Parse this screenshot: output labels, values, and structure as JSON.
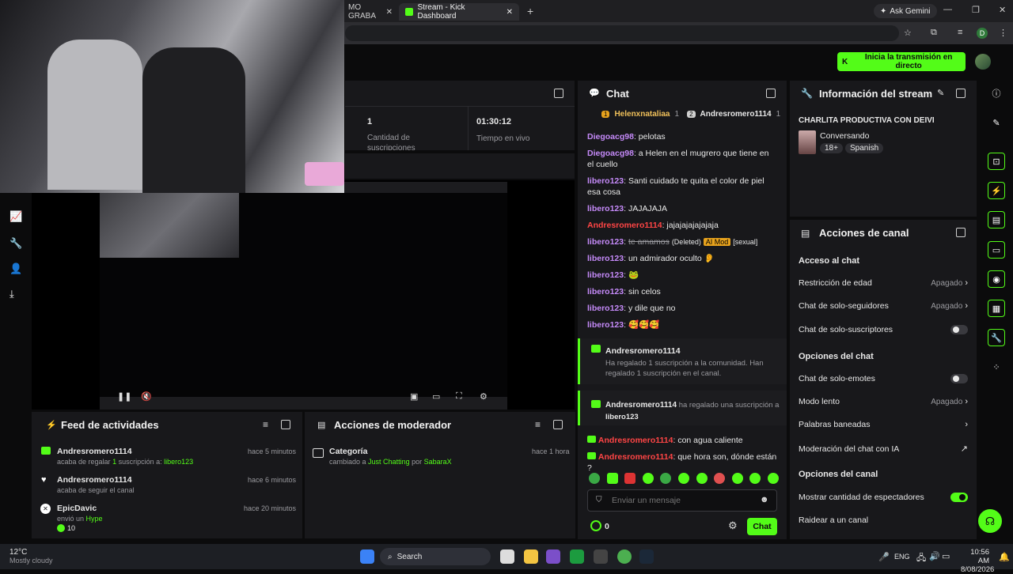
{
  "browser": {
    "tabs": [
      {
        "label": "MO GRABA"
      },
      {
        "label": "Stream - Kick Dashboard"
      }
    ],
    "ask_gemini": "Ask Gemini",
    "profile_letter": "D"
  },
  "header": {
    "go_live_label": "Inicia la transmisión en directo"
  },
  "stats": {
    "subs_value": "1",
    "subs_label": "Cantidad de suscripciones",
    "live_time_value": "01:30:12",
    "live_time_label": "Tiempo en vivo"
  },
  "chat": {
    "title": "Chat",
    "top_gifters": [
      {
        "rank": "1",
        "name": "Helenxnataliaa",
        "count": "1"
      },
      {
        "rank": "2",
        "name": "Andresromero1114",
        "count": "1"
      }
    ],
    "messages": [
      {
        "user": "Diegoacg98",
        "color": "#c58af9",
        "text": "pelotas"
      },
      {
        "user": "Diegoacg98",
        "color": "#c58af9",
        "text": "a Helen en el mugrero que tiene en el cuello"
      },
      {
        "user": "libero123",
        "color": "#c58af9",
        "text": "Santi cuidado te quita el color de piel esa cosa"
      },
      {
        "user": "libero123",
        "color": "#c58af9",
        "text": "JAJAJAJA"
      },
      {
        "user": "Andresromero1114",
        "color": "#ff4545",
        "text": "jajajajajajajaja"
      },
      {
        "user": "libero123",
        "color": "#c58af9",
        "text": "te amamos",
        "deleted": "(Deleted)",
        "badge": "AI Mod",
        "tag": "[sexual]"
      },
      {
        "user": "libero123",
        "color": "#c58af9",
        "text": "un admirador oculto 👂"
      },
      {
        "user": "libero123",
        "color": "#c58af9",
        "text": "🐸"
      },
      {
        "user": "libero123",
        "color": "#c58af9",
        "text": "sin celos"
      },
      {
        "user": "libero123",
        "color": "#c58af9",
        "text": "y dile que no"
      },
      {
        "user": "libero123",
        "color": "#c58af9",
        "text": "🥰🥰🥰"
      }
    ],
    "gift1": {
      "user": "Andresromero1114",
      "text": "Ha regalado 1 suscripción a la comunidad. Han regalado 1 suscripción en el canal."
    },
    "gift2": {
      "user": "Andresromero1114",
      "text": "ha regalado una suscripción a",
      "target": "libero123"
    },
    "messages2": [
      {
        "user": "Andresromero1114",
        "color": "#ff4545",
        "text": "con agua caliente"
      },
      {
        "user": "Andresromero1114",
        "color": "#ff4545",
        "text": "que hora son, dónde están ?"
      }
    ],
    "input_placeholder": "Enviar un mensaje",
    "points": "0",
    "send_label": "Chat"
  },
  "stream_info": {
    "title": "Información del stream",
    "stream_title": "CHARLITA PRODUCTIVA CON DEIVI",
    "category": "Conversando",
    "tags": [
      "18+",
      "Spanish"
    ]
  },
  "channel_actions": {
    "title": "Acciones de canal",
    "sections": [
      {
        "heading": "Acceso al chat",
        "items": [
          {
            "label": "Restricción de edad",
            "value": "Apagado",
            "kind": "chevron"
          },
          {
            "label": "Chat de solo-seguidores",
            "value": "Apagado",
            "kind": "chevron"
          },
          {
            "label": "Chat de solo-suscriptores",
            "value": "",
            "kind": "toggle-off"
          }
        ]
      },
      {
        "heading": "Opciones del chat",
        "items": [
          {
            "label": "Chat de solo-emotes",
            "value": "",
            "kind": "toggle-off"
          },
          {
            "label": "Modo lento",
            "value": "Apagado",
            "kind": "chevron"
          },
          {
            "label": "Palabras baneadas",
            "value": "",
            "kind": "chevron"
          },
          {
            "label": "Moderación del chat con IA",
            "value": "",
            "kind": "external"
          }
        ]
      },
      {
        "heading": "Opciones del canal",
        "items": [
          {
            "label": "Mostrar cantidad de espectadores",
            "value": "",
            "kind": "toggle-on"
          },
          {
            "label": "Raidear a un canal",
            "value": "",
            "kind": "none"
          }
        ]
      }
    ]
  },
  "activity_feed": {
    "title": "Feed de actividades",
    "items": [
      {
        "user": "Andresromero1114",
        "time": "hace 5 minutos",
        "line_a": "acaba de regalar",
        "line_b": "1",
        "line_c": "suscripción a:",
        "line_d": "libero123"
      },
      {
        "user": "Andresromero1114",
        "time": "hace 6 minutos",
        "line_a": "acaba de seguir el canal"
      },
      {
        "user": "EpicDavic",
        "time": "hace 20 minutos",
        "line_a": "envió un",
        "line_d": "Hype",
        "amount": "10"
      }
    ]
  },
  "mod_actions": {
    "title": "Acciones de moderador",
    "items": [
      {
        "heading": "Categoría",
        "time": "hace 1 hora",
        "pre": "cambiado a",
        "category": "Just Chatting",
        "by": "por",
        "mod": "SabaraX"
      }
    ]
  },
  "taskbar": {
    "temp": "12°C",
    "weather": "Mostly cloudy",
    "search": "Search",
    "lang": "ENG",
    "time": "10:56 AM",
    "date": "8/08/2026"
  }
}
